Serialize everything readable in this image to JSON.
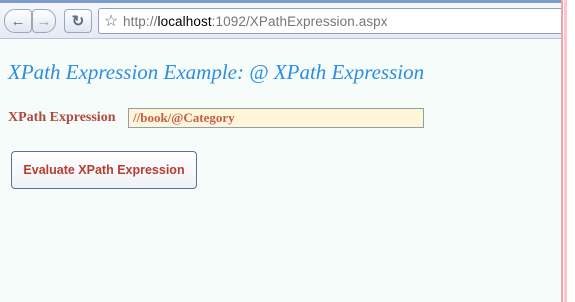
{
  "browser": {
    "back_icon": "arrow-left-icon",
    "forward_icon": "arrow-right-icon",
    "reload_icon": "reload-icon",
    "star_icon": "star-icon",
    "url_prefix": "http://",
    "url_host": "localhost",
    "url_rest": ":1092/XPathExpression.aspx"
  },
  "page": {
    "heading": "XPath Expression Example: @ XPath Expression",
    "field_label": "XPath Expression",
    "field_value": "//book/@Category",
    "button_label": "Evaluate XPath Expression"
  },
  "colors": {
    "heading": "#2d8de0",
    "label": "#b14a3e",
    "input_bg": "#fff6d7",
    "page_bg": "#f5fcfa"
  }
}
